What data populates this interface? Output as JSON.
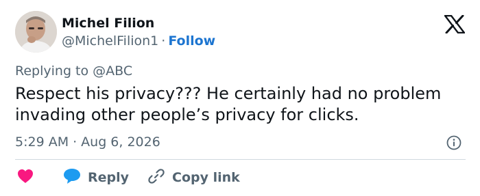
{
  "author": {
    "name": "Michel Filion",
    "handle": "@MichelFilion1",
    "separator": "·",
    "follow_label": "Follow"
  },
  "reply_to": "Replying to @ABC",
  "tweet": {
    "text": "Respect his privacy??? He certainly had no problem invading other people’s privacy for clicks."
  },
  "meta": {
    "time": "5:29 AM",
    "separator": "·",
    "date": "Aug 6, 2026"
  },
  "actions": {
    "like_icon": "heart-icon",
    "reply_label": "Reply",
    "copy_link_label": "Copy link"
  },
  "colors": {
    "text": "#0f1419",
    "muted": "#536471",
    "link": "#1d75d0",
    "like": "#f91880",
    "reply": "#1d9bf0",
    "divider": "#cfd9de"
  },
  "icons": {
    "logo": "x-logo-icon",
    "info": "info-icon",
    "reply": "speech-bubble-icon",
    "copy_link": "link-icon"
  }
}
